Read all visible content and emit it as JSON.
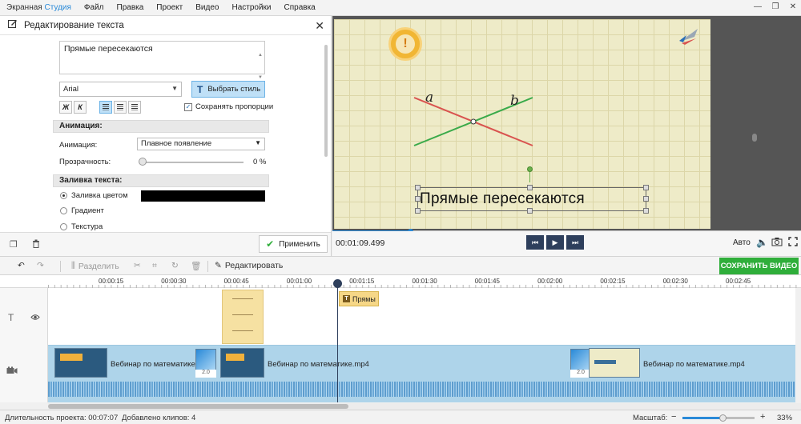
{
  "app": {
    "title_part1": "Экранная ",
    "title_part2": "Студия",
    "menu": [
      "Файл",
      "Правка",
      "Проект",
      "Видео",
      "Настройки",
      "Справка"
    ],
    "window_controls": [
      "—",
      "❐",
      "✕"
    ]
  },
  "editor": {
    "title": "Редактирование текста",
    "text_value": "Прямые пересекаются",
    "font": "Arial",
    "style_button": "Выбрать стиль",
    "bold_label": "Ж",
    "italic_label": "К",
    "keep_proportions": "Сохранять пропорции",
    "animation_section": "Анимация:",
    "animation_label": "Анимация:",
    "animation_value": "Плавное появление",
    "opacity_label": "Прозрачность:",
    "opacity_value": "0 %",
    "opacity_percent": 0,
    "fill_section": "Заливка текста:",
    "fill_options": [
      "Заливка цветом",
      "Градиент",
      "Текстура"
    ],
    "fill_color": "#000000",
    "apply_button": "Применить"
  },
  "preview": {
    "label_a": "a",
    "label_b": "b",
    "slide_text": "Прямые пересекаются",
    "timecode": "00:01:09.499",
    "quality": "Авто",
    "progress_fraction": 0.166
  },
  "toolbar": {
    "split": "Разделить",
    "edit": "Редактировать",
    "save_video": "СОХРАНИТЬ ВИДЕО"
  },
  "timeline": {
    "ticks": [
      "00:00:15",
      "00:00:30",
      "00:00:45",
      "00:01:00",
      "00:01:15",
      "00:01:30",
      "00:01:45",
      "00:02:00",
      "00:02:15",
      "00:02:30",
      "00:02:45"
    ],
    "text_clip_label": "Прямы",
    "clip_labels": [
      "Вебинар по математике.m",
      "Вебинар по математике.mp4",
      "Вебинар по математике.mp4"
    ],
    "transition_values": [
      "2.0",
      "2.0"
    ]
  },
  "status": {
    "duration": "Длительность проекта: 00:07:07",
    "clips_added": "Добавлено клипов: 4",
    "zoom_label": "Масштаб:",
    "zoom_minus": "−",
    "zoom_plus": "+",
    "zoom_value": "33%",
    "zoom_fraction": 0.55
  },
  "colors": {
    "accent": "#2a8ad8",
    "save_green": "#2fae3a",
    "line_red": "#d9534f",
    "line_green": "#3aaa4a"
  }
}
